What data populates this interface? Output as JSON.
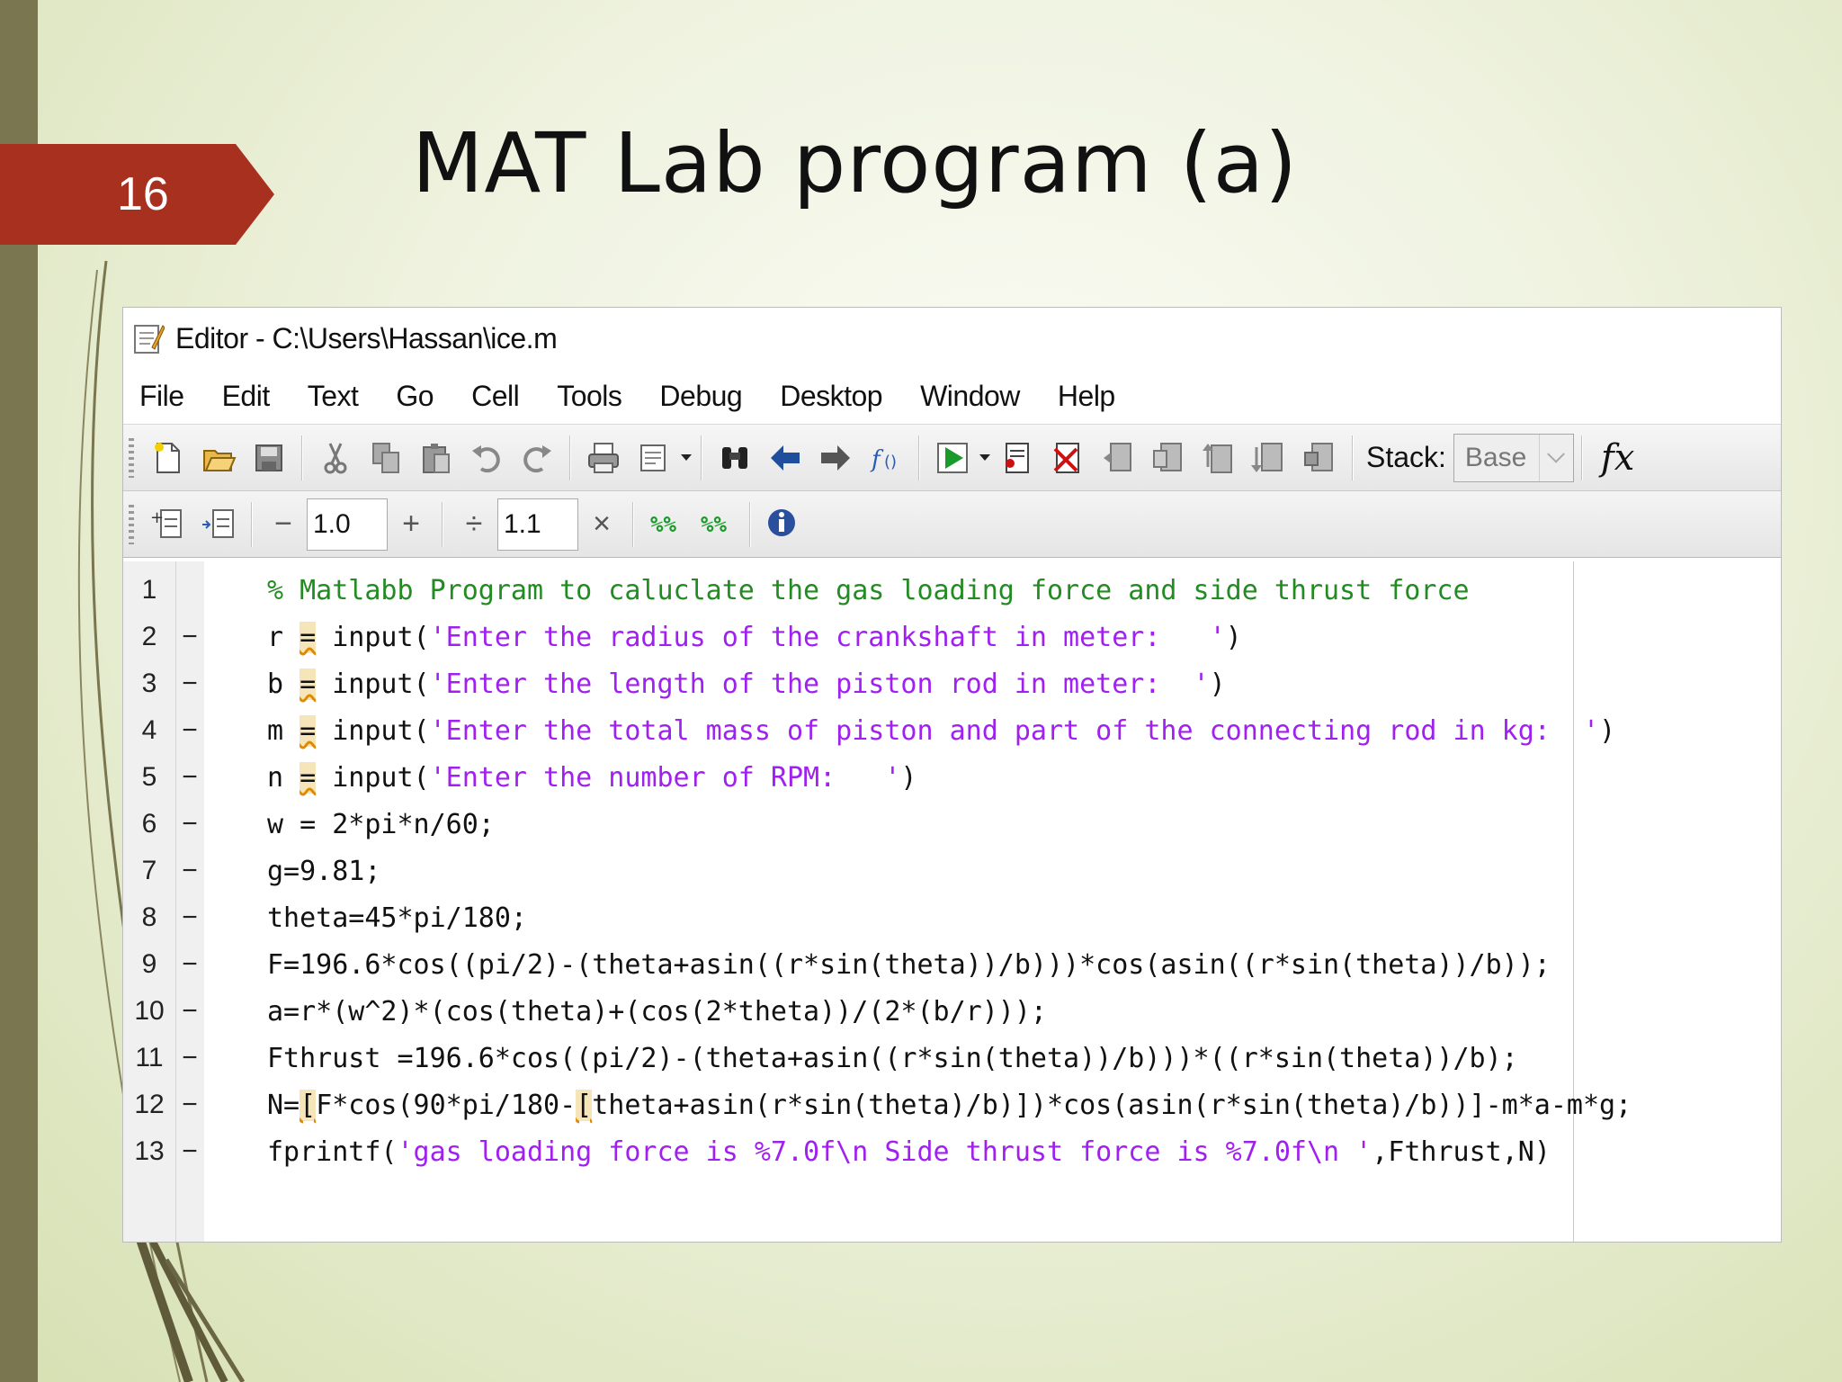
{
  "slide": {
    "number": "16",
    "title": "MAT Lab program (a)"
  },
  "editor": {
    "title": "Editor - C:\\Users\\Hassan\\ice.m",
    "menu": [
      "File",
      "Edit",
      "Text",
      "Go",
      "Cell",
      "Tools",
      "Debug",
      "Desktop",
      "Window",
      "Help"
    ],
    "toolbar": {
      "stack_label": "Stack:",
      "stack_value": "Base",
      "fx_label": "fx"
    },
    "cellbar": {
      "decrement": "−",
      "value1": "1.0",
      "increment": "+",
      "divide": "÷",
      "value2": "1.1",
      "multiply": "×"
    },
    "lines": [
      {
        "n": "1",
        "mark": "",
        "segs": [
          {
            "t": "% Matlabb Program to caluclate the gas loading force and side thrust force",
            "c": "com"
          }
        ]
      },
      {
        "n": "2",
        "mark": "−",
        "segs": [
          {
            "t": "r ",
            "c": ""
          },
          {
            "t": "=",
            "c": "warn"
          },
          {
            "t": " input(",
            "c": ""
          },
          {
            "t": "'Enter the radius of the crankshaft in meter:   '",
            "c": "str"
          },
          {
            "t": ")",
            "c": ""
          }
        ]
      },
      {
        "n": "3",
        "mark": "−",
        "segs": [
          {
            "t": "b ",
            "c": ""
          },
          {
            "t": "=",
            "c": "warn"
          },
          {
            "t": " input(",
            "c": ""
          },
          {
            "t": "'Enter the length of the piston rod in meter:  '",
            "c": "str"
          },
          {
            "t": ")",
            "c": ""
          }
        ]
      },
      {
        "n": "4",
        "mark": "−",
        "segs": [
          {
            "t": "m ",
            "c": ""
          },
          {
            "t": "=",
            "c": "warn"
          },
          {
            "t": " input(",
            "c": ""
          },
          {
            "t": "'Enter the total mass of piston and part of the connecting rod in kg:  '",
            "c": "str"
          },
          {
            "t": ")",
            "c": ""
          }
        ]
      },
      {
        "n": "5",
        "mark": "−",
        "segs": [
          {
            "t": "n ",
            "c": ""
          },
          {
            "t": "=",
            "c": "warn"
          },
          {
            "t": " input(",
            "c": ""
          },
          {
            "t": "'Enter the number of RPM:   '",
            "c": "str"
          },
          {
            "t": ")",
            "c": ""
          }
        ]
      },
      {
        "n": "6",
        "mark": "−",
        "segs": [
          {
            "t": "w = 2*pi*n/60;",
            "c": ""
          }
        ]
      },
      {
        "n": "7",
        "mark": "−",
        "segs": [
          {
            "t": "g=9.81;",
            "c": ""
          }
        ]
      },
      {
        "n": "8",
        "mark": "−",
        "segs": [
          {
            "t": "theta=45*pi/180;",
            "c": ""
          }
        ]
      },
      {
        "n": "9",
        "mark": "−",
        "segs": [
          {
            "t": "F=196.6*cos((pi/2)-(theta+asin((r*sin(theta))/b)))*cos(asin((r*sin(theta))/b));",
            "c": ""
          }
        ]
      },
      {
        "n": "10",
        "mark": "−",
        "segs": [
          {
            "t": "a=r*(w^2)*(cos(theta)+(cos(2*theta))/(2*(b/r)));",
            "c": ""
          }
        ]
      },
      {
        "n": "11",
        "mark": "−",
        "segs": [
          {
            "t": "Fthrust =196.6*cos((pi/2)-(theta+asin((r*sin(theta))/b)))*((r*sin(theta))/b);",
            "c": ""
          }
        ]
      },
      {
        "n": "12",
        "mark": "−",
        "segs": [
          {
            "t": "N=",
            "c": ""
          },
          {
            "t": "[",
            "c": "warn"
          },
          {
            "t": "F*cos(90*pi/180-",
            "c": ""
          },
          {
            "t": "[",
            "c": "warn"
          },
          {
            "t": "theta+asin(r*sin(theta)/b)])*cos(asin(r*sin(theta)/b))]-m*a-m*g;",
            "c": ""
          }
        ]
      },
      {
        "n": "13",
        "mark": "−",
        "segs": [
          {
            "t": "fprintf(",
            "c": ""
          },
          {
            "t": "'gas loading force is %7.0f\\n Side thrust force is %7.0f\\n '",
            "c": "str"
          },
          {
            "t": ",Fthrust,N)",
            "c": ""
          }
        ]
      }
    ]
  },
  "colors": {
    "badge": "#a8301f",
    "comment": "#228b22",
    "string": "#a020f0"
  }
}
